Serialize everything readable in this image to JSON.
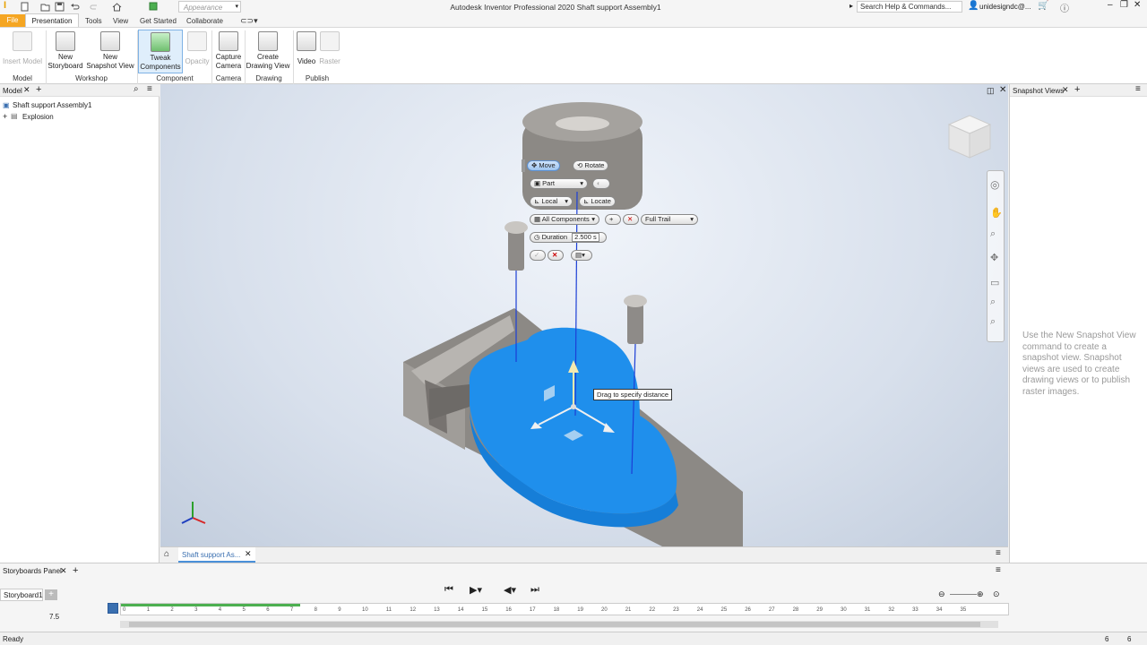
{
  "titlebar": {
    "title": "Autodesk Inventor Professional 2020    Shaft support Assembly1",
    "appearance": "Appearance",
    "search_placeholder": "Search Help & Commands...",
    "user": "unidesigndc@..."
  },
  "menu": {
    "file": "File",
    "items": [
      "Presentation",
      "Tools",
      "View",
      "Get Started",
      "Collaborate"
    ]
  },
  "ribbon": {
    "buttons": {
      "insert_model": "Insert Model",
      "new_storyboard": [
        "New",
        "Storyboard"
      ],
      "new_snapshot": [
        "New",
        "Snapshot View"
      ],
      "tweak": [
        "Tweak",
        "Components"
      ],
      "opacity": "Opacity",
      "capture": [
        "Capture",
        "Camera"
      ],
      "drawing": [
        "Create",
        "Drawing View"
      ],
      "video": "Video",
      "raster": "Raster"
    },
    "groups": [
      "Model",
      "Workshop",
      "Component",
      "Camera",
      "Drawing",
      "Publish"
    ]
  },
  "browser": {
    "title": "Model",
    "root": "Shaft support Assembly1",
    "child": "Explosion"
  },
  "minitoolbar": {
    "move": "Move",
    "rotate": "Rotate",
    "part": "Part",
    "local": "Local",
    "locate": "Locate",
    "all_components": "All Components",
    "full_trail": "Full Trail",
    "duration_label": "Duration",
    "duration_value": "2.500 s"
  },
  "tooltip": "Drag to specify distance",
  "doc_tab": "Shaft support As...",
  "snapshot": {
    "title": "Snapshot Views",
    "message": "Use the New Snapshot View command to create a snapshot view. Snapshot views are used to create drawing views or to publish raster images."
  },
  "storyboard": {
    "panel_title": "Storyboards Panel",
    "tab": "Storyboard1",
    "time": "7.5",
    "ticks": [
      "0",
      "1",
      "2",
      "3",
      "4",
      "5",
      "6",
      "7",
      "8",
      "9",
      "10",
      "11",
      "12",
      "13",
      "14",
      "15",
      "16",
      "17",
      "18",
      "19",
      "20",
      "21",
      "22",
      "23",
      "24",
      "25",
      "26",
      "27",
      "28",
      "29",
      "30",
      "31",
      "32",
      "33",
      "34",
      "35"
    ]
  },
  "status": {
    "text": "Ready",
    "num1": "6",
    "num2": "6"
  },
  "colors": {
    "file_tab": "#f5a623",
    "selection_blue": "#1e90ef",
    "timeline_green": "#4caf50"
  }
}
